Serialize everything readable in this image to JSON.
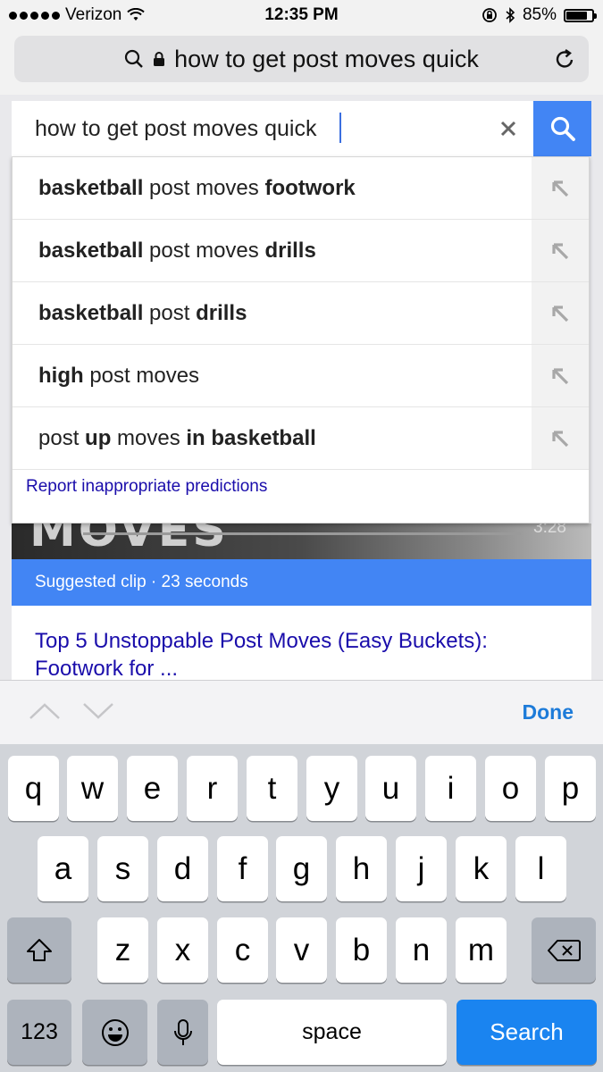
{
  "status_bar": {
    "carrier": "Verizon",
    "time": "12:35 PM",
    "battery": "85%"
  },
  "url_bar": {
    "text": "how to get post moves quick"
  },
  "search": {
    "value": "how to get post moves quick"
  },
  "suggestions": [
    {
      "bold1": "basketball",
      "plain": " post moves ",
      "bold2": "footwork"
    },
    {
      "bold1": "basketball",
      "plain": " post moves ",
      "bold2": "drills"
    },
    {
      "bold1": "basketball",
      "plain": " post ",
      "bold2": "drills"
    },
    {
      "bold1": "high",
      "plain": " post moves",
      "bold2": ""
    },
    {
      "pre": "post ",
      "bold1": "up",
      "plain": " moves ",
      "bold2": "in basketball"
    }
  ],
  "report_link": "Report inappropriate predictions",
  "result": {
    "thumb_text": "MOVES",
    "duration": "3:28",
    "clip_label": "Suggested clip · 23 seconds",
    "title": "Top 5 Unstoppable Post Moves (Easy Buckets): Footwork for ..."
  },
  "keyboard_toolbar": {
    "done": "Done"
  },
  "keyboard": {
    "row1": [
      "q",
      "w",
      "e",
      "r",
      "t",
      "y",
      "u",
      "i",
      "o",
      "p"
    ],
    "row2": [
      "a",
      "s",
      "d",
      "f",
      "g",
      "h",
      "j",
      "k",
      "l"
    ],
    "row3": [
      "z",
      "x",
      "c",
      "v",
      "b",
      "n",
      "m"
    ],
    "numbers": "123",
    "space": "space",
    "action": "Search"
  },
  "colors": {
    "accent": "#4285f4",
    "link": "#1a0dab",
    "ios_blue": "#1a84f0"
  }
}
